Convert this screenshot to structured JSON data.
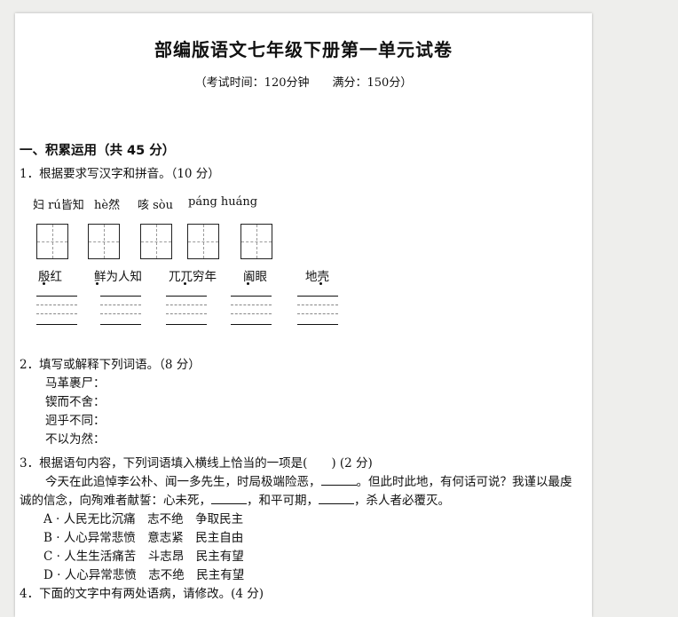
{
  "title": "部编版语文七年级下册第一单元试卷",
  "subtitle": {
    "time": "（考试时间：120分钟",
    "score": "满分：150分）"
  },
  "section1": "一、积累运用（共 45 分）",
  "q1": {
    "text": "1．根据要求写汉字和拼音。（10 分）",
    "pinyin": [
      "妇 rú皆知",
      "hè然",
      "咳 sòu",
      "páng huáng"
    ],
    "words": [
      "殷红",
      "鲜为人知",
      "兀兀穷年",
      "阖眼",
      "地壳"
    ]
  },
  "q2": {
    "text": "2．填写或解释下列词语。（8 分）",
    "items": [
      "马革裹尸：",
      "锲而不舍：",
      "迥乎不同：",
      "不以为然："
    ]
  },
  "q3": {
    "text": "3．根据语句内容，下列词语填入横线上恰当的一项是(　　) (2 分)",
    "para1_a": "今天在此追悼李公朴、闻一多先生，时局极端险恶，",
    "para1_b": "。但此时此地，有何话可说？我谨以最虔",
    "para2_a": "诚的信念，向殉难者献誓：心未死，",
    "para2_b": "，和平可期，",
    "para2_c": "，杀人者必覆灭。",
    "options": [
      "A · 人民无比沉痛　志不绝　争取民主",
      "B · 人心异常悲愤　意志紧　民主自由",
      "C · 人生生活痛苦　斗志昂　民主有望",
      "D · 人心异常悲愤　志不绝　民主有望"
    ]
  },
  "q4": {
    "text": "4．下面的文字中有两处语病，请修改。(4 分)"
  }
}
